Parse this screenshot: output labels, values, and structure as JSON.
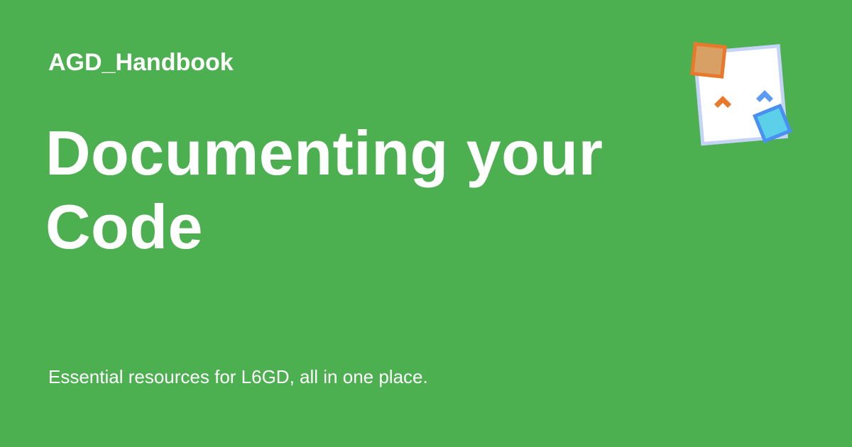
{
  "card": {
    "background": "#4caf50",
    "site_name": "AGD_Handbook",
    "title": "Documenting your Code",
    "tagline": "Essential resources for L6GD, all in one place."
  },
  "logo": {
    "icon": "docs-logo-icon",
    "colors": {
      "sheet_fill": "#ffffff",
      "sheet_border": "#c5d3f7",
      "orange_square_fill": "#d9a066",
      "orange_square_border": "#e8792b",
      "orange_chevron": "#e8792b",
      "blue_chevron": "#5b9bf6",
      "cyan_square_fill": "#5bd0e8",
      "cyan_square_border": "#4a90f0"
    }
  }
}
